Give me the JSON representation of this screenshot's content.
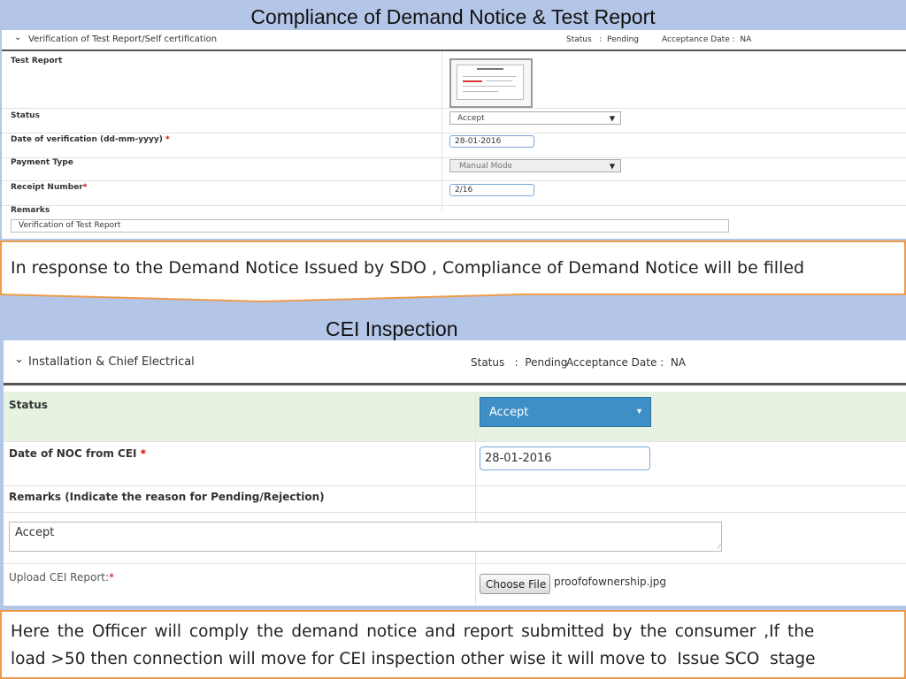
{
  "top": {
    "title": "Compliance of Demand Notice & Test Report",
    "header_label": "Verification of Test Report/Self certification",
    "status_text": "Status   :  Pending",
    "acceptance_text": "Acceptance Date :  NA",
    "fields": {
      "test_report_label": "Test Report",
      "status_label": "Status",
      "status_value": "Accept",
      "date_label": "Date of verification (dd-mm-yyyy)",
      "date_value": "28-01-2016",
      "payment_label": "Payment Type",
      "payment_value": "Manual Mode",
      "receipt_label": "Receipt Number",
      "receipt_value": "2/16",
      "remarks_label": "Remarks",
      "remarks_value": "Verification of Test Report"
    }
  },
  "callout1": "In response to the Demand Notice Issued by SDO , Compliance of Demand Notice will be filled",
  "bottom": {
    "title": "CEI Inspection",
    "header_label": "Installation & Chief Electrical",
    "status_text": "Status   :  Pending",
    "acceptance_text": "Acceptance Date :  NA",
    "fields": {
      "status_label": "Status",
      "status_value": "Accept",
      "noc_label": "Date of NOC from CEI",
      "noc_value": "28-01-2016",
      "remarks_label": "Remarks (Indicate the reason for Pending/Rejection)",
      "remarks_value": "Accept",
      "upload_label": "Upload CEI Report:",
      "choose_file": "Choose File",
      "file_name": "proofofownership.jpg"
    }
  },
  "callout2": {
    "line1": "Here the Officer will comply the demand notice and report submitted by the consumer ,If the",
    "line2": "load >50 then connection will move for CEI inspection other wise it will move to  Issue SCO  stage"
  },
  "colors": {
    "slide_bg": "#b4c6e7",
    "callout_border": "#ed9b4a",
    "accent_select": "#3e8fc6",
    "status_row": "#e5f3e0"
  }
}
